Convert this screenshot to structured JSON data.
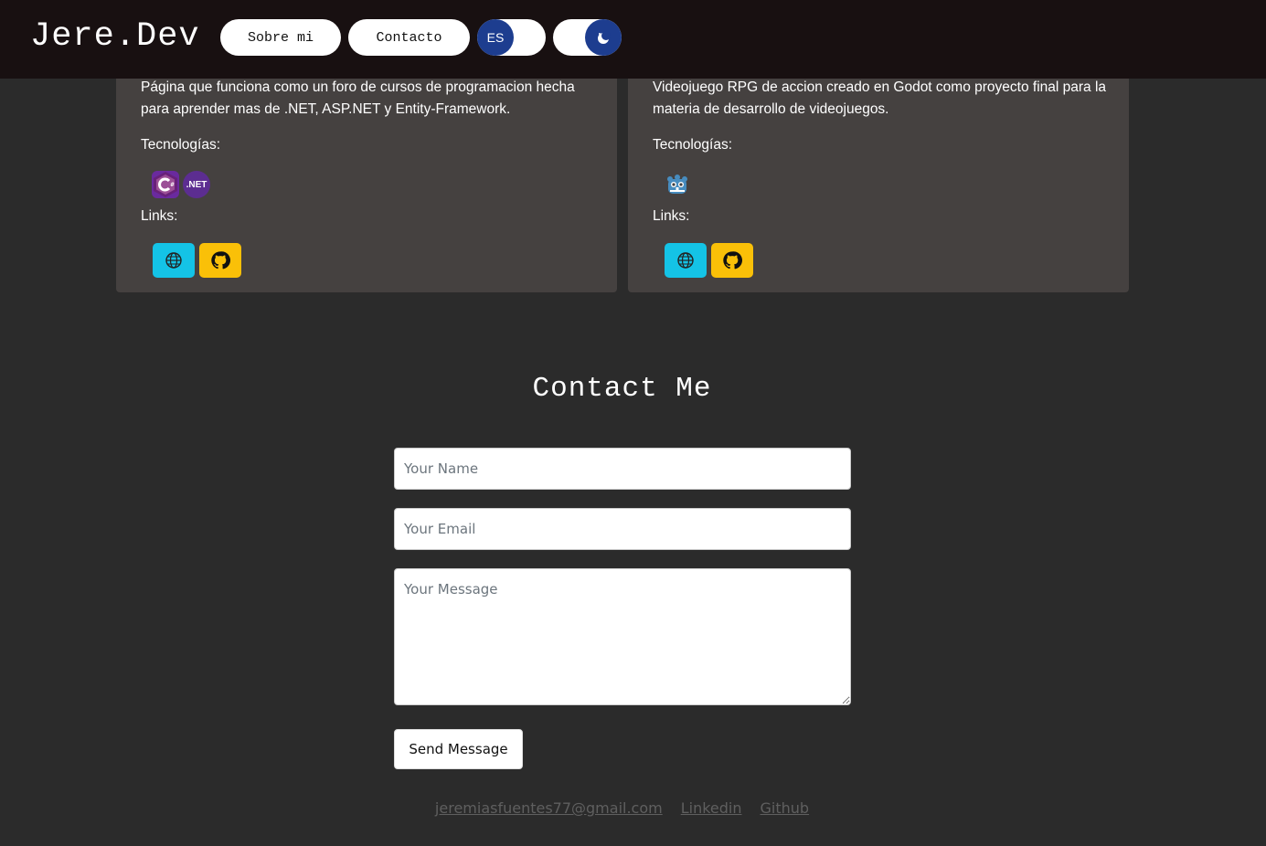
{
  "header": {
    "brand": "Jere.Dev",
    "nav": {
      "about": "Sobre mi",
      "contact": "Contacto"
    },
    "lang_toggle": {
      "value": "ES"
    },
    "theme_toggle": {
      "icon": "moon-icon"
    }
  },
  "projects": [
    {
      "description": "Página que funciona como un foro de cursos de programacion hecha para aprender mas de .NET, ASP.NET y Entity-Framework.",
      "tech_label": "Tecnologías:",
      "tech_icons": [
        "csharp-icon",
        "dotnet-icon"
      ],
      "dotnet_text": ".NET",
      "links_label": "Links:"
    },
    {
      "description": "Videojuego RPG de accion creado en Godot como proyecto final para la materia de desarrollo de videojuegos.",
      "tech_label": "Tecnologías:",
      "tech_icons": [
        "godot-icon"
      ],
      "links_label": "Links:"
    }
  ],
  "contact": {
    "title": "Contact Me",
    "name_placeholder": "Your Name",
    "email_placeholder": "Your Email",
    "message_placeholder": "Your Message",
    "send_label": "Send Message"
  },
  "footer": {
    "email": "jeremiasfuentes77@gmail.com",
    "linkedin": "Linkedin",
    "github": "Github"
  },
  "colors": {
    "header_bg": "#181011",
    "page_bg": "#2b2b2b",
    "card_bg": "#454140",
    "accent_blue": "#1d3d8f",
    "web_btn": "#14c3e6",
    "github_btn": "#fac008"
  }
}
